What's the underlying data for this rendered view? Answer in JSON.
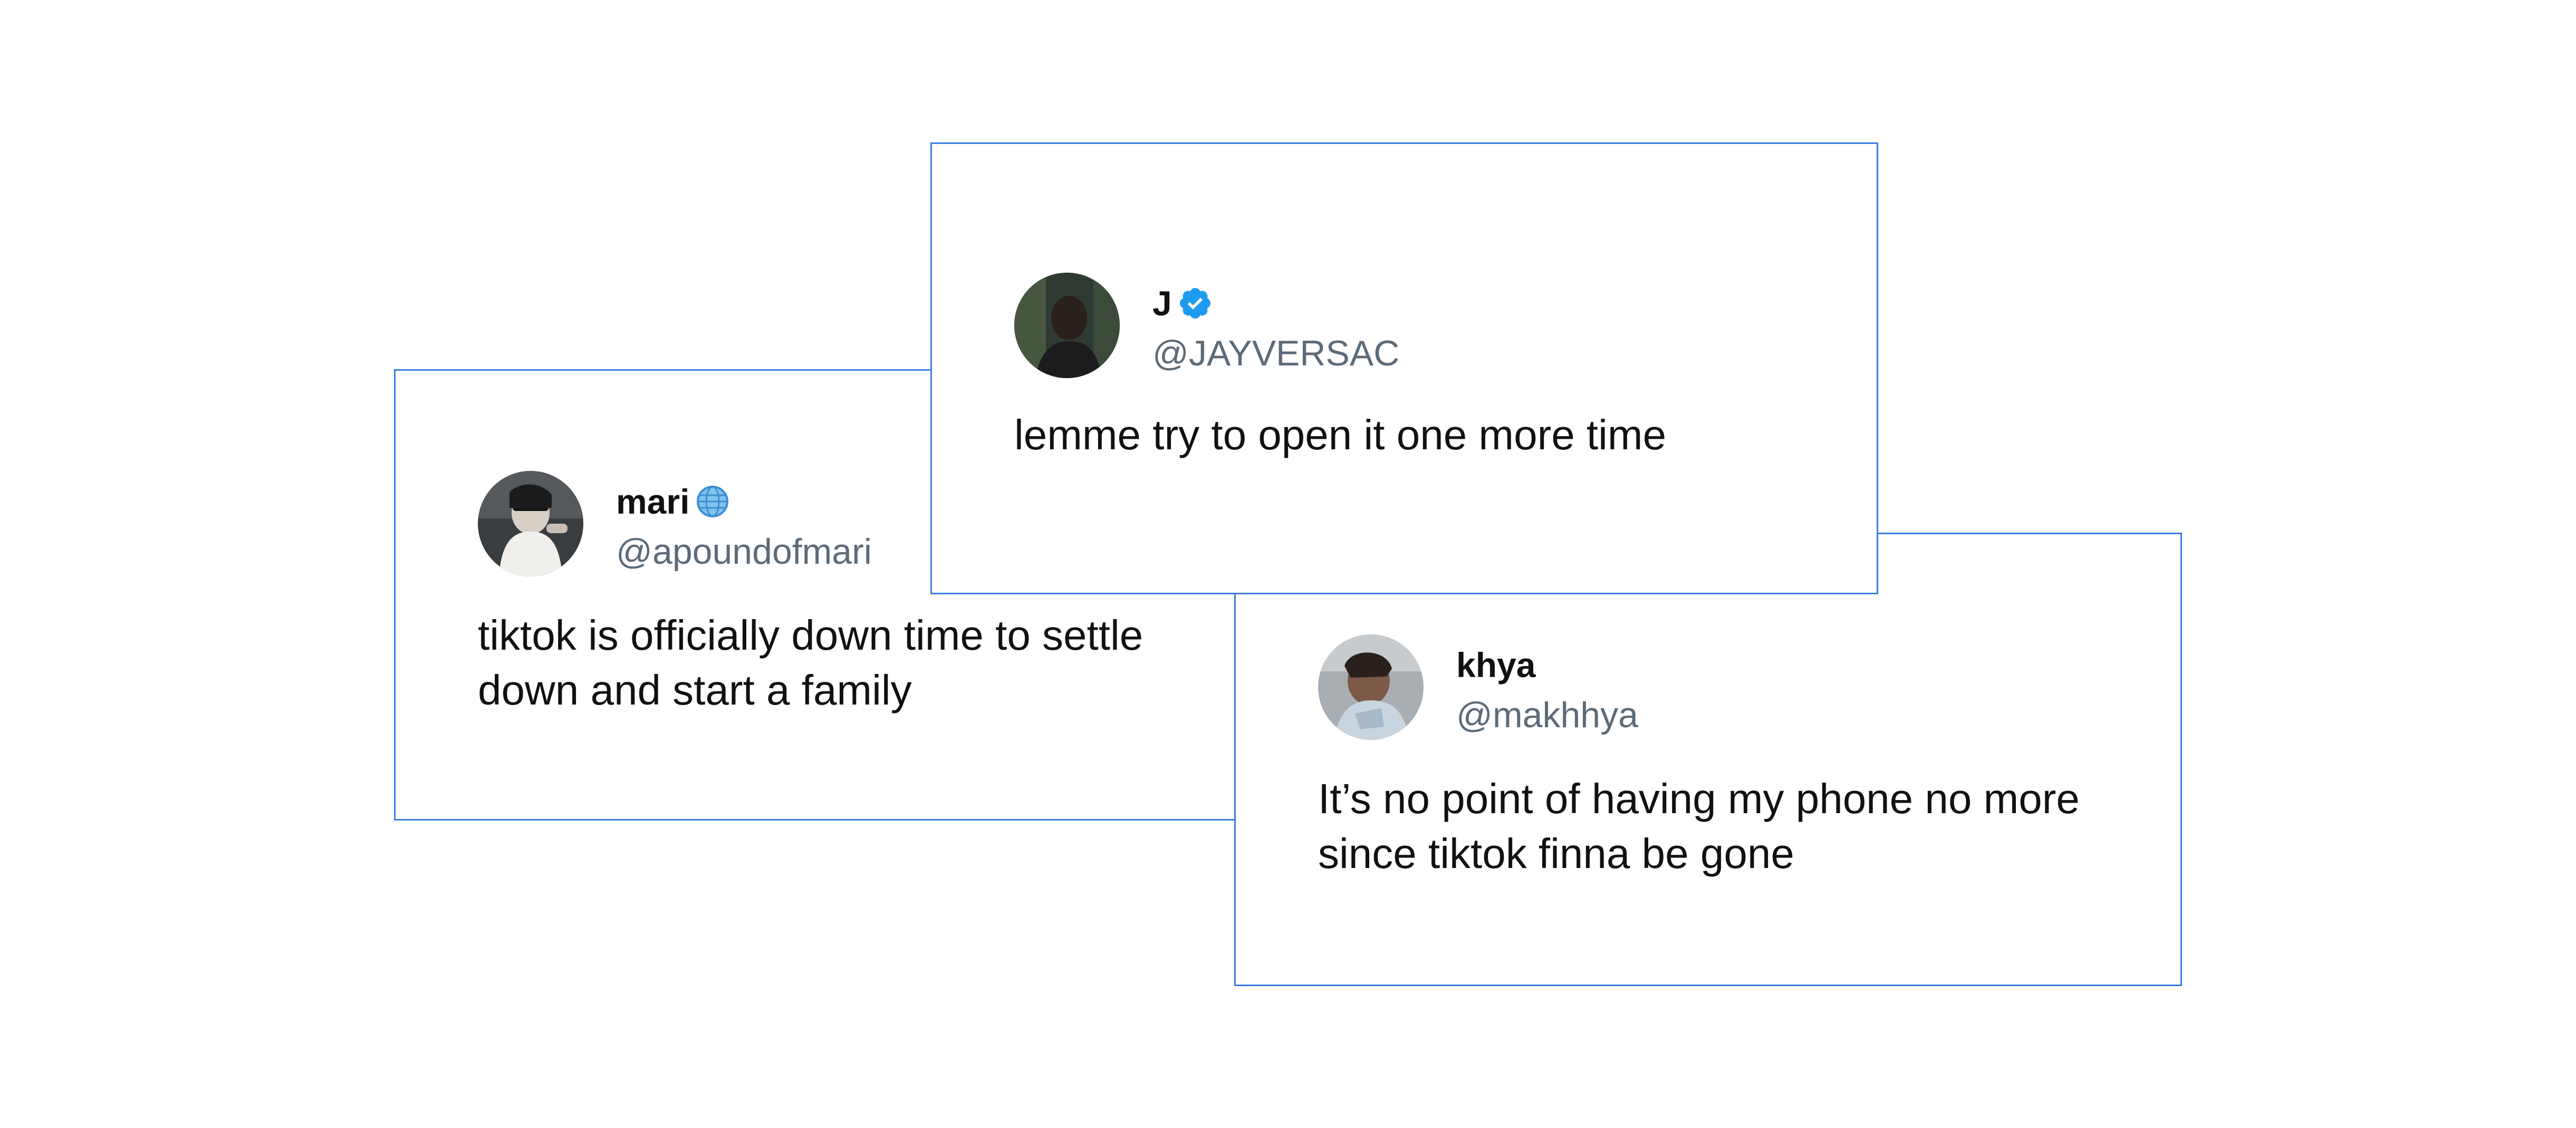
{
  "tweets": [
    {
      "id": "mari",
      "display_name": "mari",
      "handle": "@apoundofmari",
      "badge_icon": "globe-icon",
      "text": "tiktok is officially down time to settle down and start a family"
    },
    {
      "id": "j",
      "display_name": "J",
      "handle": "@JAYVERSAC",
      "badge_icon": "verified-badge-icon",
      "text": "lemme try to open it one more time"
    },
    {
      "id": "khya",
      "display_name": "khya",
      "handle": "@makhhya",
      "badge_icon": "",
      "text": "It’s no point of having my phone no more since tiktok finna be gone"
    }
  ],
  "colors": {
    "card_border": "#3d7ee0",
    "handle_text": "#5d6b79",
    "verified_blue": "#1d9bf0"
  }
}
